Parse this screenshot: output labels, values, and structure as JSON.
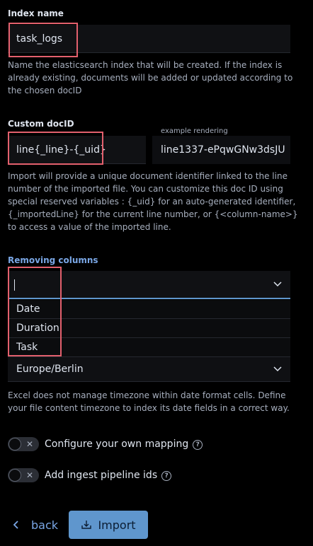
{
  "index_name": {
    "label": "Index name",
    "value": "task_logs",
    "help": "Name the elasticsearch index that will be created. If the index is already existing, documents will be added or updated according to the chosen docID"
  },
  "custom_docid": {
    "label": "Custom docID",
    "value": "line{_line}-{_uid}",
    "example_label": "example rendering",
    "example_value": "line1337-ePqwGNw3dsJU",
    "help": "Import will provide a unique document identifier linked to the line number of the imported file. You can customize this doc ID using special reserved variables : {_uid} for an auto-generated identifier, {_importedLine} for the current line number, or {<column-name>} to access a value of the imported line."
  },
  "removing_columns": {
    "label": "Removing columns",
    "value": "",
    "options": [
      "Date",
      "Duration",
      "Task"
    ]
  },
  "timezone": {
    "value": "Europe/Berlin",
    "help": "Excel does not manage timezone within date format cells. Define your file content timezone to index its date fields in a correct way."
  },
  "toggles": {
    "mapping_label": "Configure your own mapping",
    "pipeline_label": "Add ingest pipeline ids"
  },
  "footer": {
    "back_label": "back",
    "import_label": "Import"
  },
  "colors": {
    "accent": "#5f96cd",
    "link": "#7aa7e6",
    "highlight": "#e3606d"
  }
}
